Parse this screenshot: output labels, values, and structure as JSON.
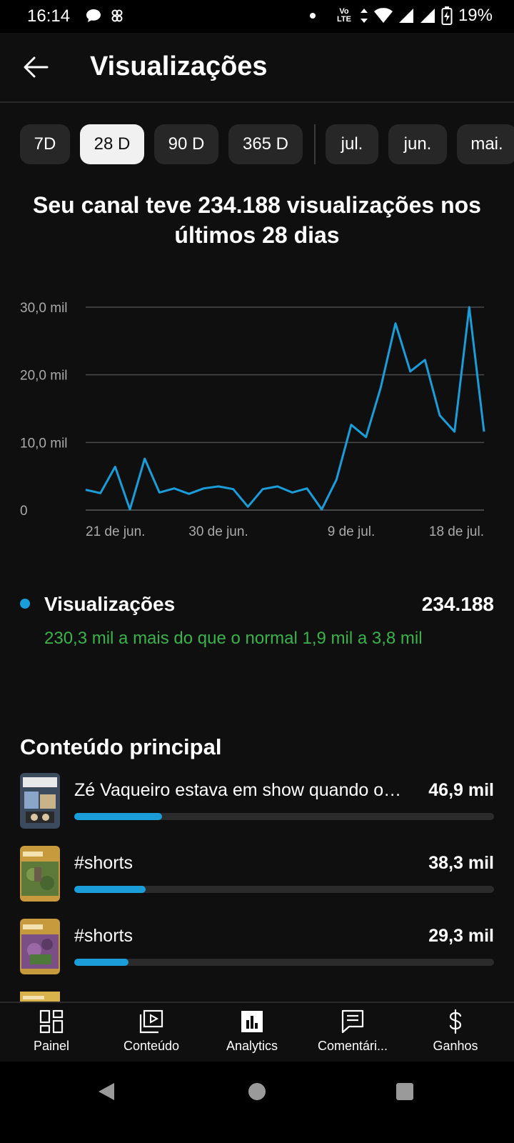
{
  "status_bar": {
    "time": "16:14",
    "network": "Vo LTE",
    "battery": "19%",
    "icons": [
      "chat-bubble-icon",
      "app-icon",
      "notification-dot-icon",
      "data-arrows-icon",
      "wifi-icon",
      "signal-icon",
      "signal-icon",
      "battery-charging-icon"
    ]
  },
  "header": {
    "title": "Visualizações",
    "back_icon": "arrow-left-icon"
  },
  "period_chips": [
    {
      "label": "7D",
      "selected": false
    },
    {
      "label": "28 D",
      "selected": true
    },
    {
      "label": "90 D",
      "selected": false
    },
    {
      "label": "365 D",
      "selected": false
    },
    {
      "label": "jul.",
      "selected": false
    },
    {
      "label": "jun.",
      "selected": false
    },
    {
      "label": "mai.",
      "selected": false
    }
  ],
  "headline": "Seu canal teve 234.188 visualizações nos últimos 28 dias",
  "chart_data": {
    "type": "line",
    "title": "",
    "xlabel": "",
    "ylabel": "",
    "x_tick_labels": [
      "21 de jun.",
      "30 de jun.",
      "9 de jul.",
      "18 de jul."
    ],
    "y_tick_labels": [
      "30,0 mil",
      "20,0 mil",
      "10,0 mil",
      "0"
    ],
    "ylim": [
      0,
      30000
    ],
    "grid": true,
    "line_color": "#1a9dd9",
    "x": [
      "21/06",
      "22/06",
      "23/06",
      "24/06",
      "25/06",
      "26/06",
      "27/06",
      "28/06",
      "29/06",
      "30/06",
      "01/07",
      "02/07",
      "03/07",
      "04/07",
      "05/07",
      "06/07",
      "07/07",
      "08/07",
      "09/07",
      "10/07",
      "11/07",
      "12/07",
      "13/07",
      "14/07",
      "15/07",
      "16/07",
      "17/07",
      "18/07",
      "19/07"
    ],
    "series": [
      {
        "values": [
          3000,
          2500,
          6400,
          100,
          7600,
          2600,
          3200,
          2400,
          3200,
          3500,
          3100,
          500,
          3100,
          3500,
          2600,
          3200,
          100,
          4500,
          12600,
          10800,
          18100,
          27600,
          20500,
          22200,
          14000,
          11600,
          30000,
          11600
        ]
      }
    ]
  },
  "metric": {
    "name": "Visualizações",
    "value": "234.188",
    "comparison": "230,3 mil a mais do que o normal 1,9 mil a 3,8 mil",
    "dot_color": "#1a9dd9",
    "comparison_color": "#39b34a"
  },
  "top_content": {
    "title": "Conteúdo principal",
    "items": [
      {
        "title": "Zé Vaqueiro estava em show quando o s...",
        "value": "46,9 mil",
        "bar_fraction": 0.21
      },
      {
        "title": "#shorts",
        "value": "38,3 mil",
        "bar_fraction": 0.17
      },
      {
        "title": "#shorts",
        "value": "29,3 mil",
        "bar_fraction": 0.13
      }
    ]
  },
  "bottom_nav": [
    {
      "label": "Painel",
      "icon": "dashboard-icon"
    },
    {
      "label": "Conteúdo",
      "icon": "video-library-icon"
    },
    {
      "label": "Analytics",
      "icon": "analytics-icon",
      "selected": true
    },
    {
      "label": "Comentári...",
      "icon": "comments-icon"
    },
    {
      "label": "Ganhos",
      "icon": "dollar-icon"
    }
  ],
  "system_nav": [
    "back-triangle-icon",
    "home-circle-icon",
    "recents-square-icon"
  ]
}
